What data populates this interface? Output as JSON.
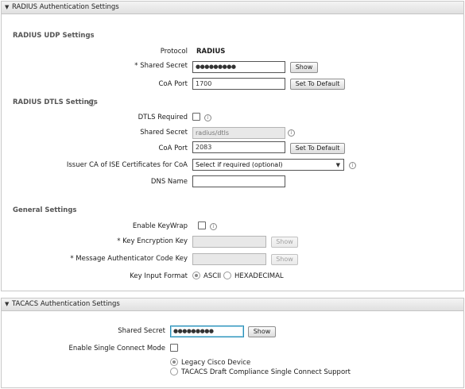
{
  "radius": {
    "header": "RADIUS Authentication Settings",
    "udp": {
      "title": "RADIUS UDP Settings",
      "protocol_label": "Protocol",
      "protocol_value": "RADIUS",
      "shared_secret_label": "* Shared Secret",
      "shared_secret_value": "●●●●●●●●●",
      "show_label": "Show",
      "coa_port_label": "CoA Port",
      "coa_port_value": "1700",
      "set_default_label": "Set To Default"
    },
    "dtls": {
      "title": "RADIUS DTLS Settings",
      "dtls_required_label": "DTLS Required",
      "shared_secret_label": "Shared Secret",
      "shared_secret_value": "radius/dtls",
      "coa_port_label": "CoA Port",
      "coa_port_value": "2083",
      "set_default_label": "Set To Default",
      "issuer_ca_label": "Issuer CA of ISE Certificates for CoA",
      "issuer_ca_value": "Select if required (optional)",
      "dns_name_label": "DNS Name",
      "dns_name_value": ""
    },
    "general": {
      "title": "General Settings",
      "keywrap_label": "Enable KeyWrap",
      "kek_label": "* Key Encryption Key",
      "kek_show_label": "Show",
      "mack_label": "* Message Authenticator Code Key",
      "mack_show_label": "Show",
      "key_format_label": "Key Input Format",
      "format_ascii": "ASCII",
      "format_hex": "HEXADECIMAL"
    }
  },
  "tacacs": {
    "header": "TACACS Authentication Settings",
    "shared_secret_label": "Shared Secret",
    "shared_secret_value": "●●●●●●●●●",
    "show_label": "Show",
    "single_connect_label": "Enable Single Connect Mode",
    "option_legacy": "Legacy Cisco Device",
    "option_draft": "TACACS Draft Compliance Single Connect Support"
  },
  "icons": {
    "collapse": "triangle-down-icon",
    "info": "info-icon",
    "dropdown": "chevron-down-icon"
  }
}
